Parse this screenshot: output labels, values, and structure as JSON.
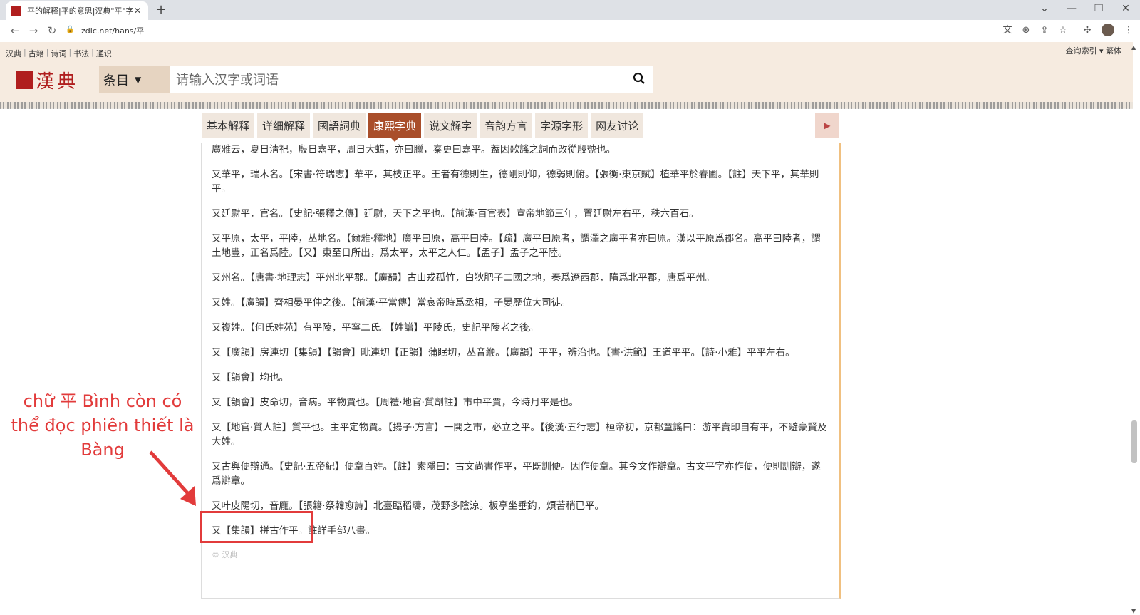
{
  "browser": {
    "tab_title": "平的解释|平的意思|汉典\"平\"字的",
    "tab_close": "✕",
    "new_tab": "+",
    "url": "zdic.net/hans/平",
    "win_minimize": "—",
    "win_restore": "❐",
    "win_close": "✕",
    "win_menu": "⌄"
  },
  "site": {
    "top_links": [
      "汉典",
      "古籍",
      "诗词",
      "书法",
      "通识"
    ],
    "top_right": "查询索引 ▾ 繁体",
    "logo_text": "漢典",
    "category_label": "条目",
    "search_placeholder": "请输入汉字或词语"
  },
  "tabs": [
    {
      "label": "基本解释",
      "active": false
    },
    {
      "label": "详细解释",
      "active": false
    },
    {
      "label": "國語詞典",
      "active": false
    },
    {
      "label": "康熙字典",
      "active": true
    },
    {
      "label": "说文解字",
      "active": false
    },
    {
      "label": "音韵方言",
      "active": false
    },
    {
      "label": "字源字形",
      "active": false
    },
    {
      "label": "网友讨论",
      "active": false
    }
  ],
  "content": {
    "paragraphs": [
      "廣雅云，夏日淸祀，殷日嘉平，周日大蜡，亦曰臘，秦更曰嘉平。葢因歌謠之詞而改從殷號也。",
      "又華平，瑞木名。【宋書·符瑞志】華平，其枝正平。王者有德則生，德剛則仰，德弱則俯。【張衡·東京賦】植華平於春圃。【註】天下平，其華則平。",
      "又廷尉平，官名。【史記·張釋之傳】廷尉，天下之平也。【前漢·百官表】宣帝地節三年，置廷尉左右平，秩六百石。",
      "又平原，太平，平陸，丛地名。【爾雅·釋地】廣平曰原，高平曰陸。【疏】廣平曰原者，謂澤之廣平者亦曰原。漢以平原爲郡名。高平曰陸者，謂土地豐，正名爲陸。【又】東至日所出，爲太平，太平之人仁。【孟子】孟子之平陸。",
      "又州名。【唐書·地理志】平州北平郡。【廣韻】古山戎孤竹，白狄肥子二國之地，秦爲遼西郡，隋爲北平郡，唐爲平州。",
      "又姓。【廣韻】齊相晏平仲之後。【前漢·平當傳】當哀帝時爲丞相，子晏歷位大司徒。",
      "又複姓。【何氏姓苑】有平陵，平寧二氏。【姓譜】平陵氏，史記平陵老之後。",
      "又【廣韻】房連切【集韻】【韻會】毗連切【正韻】蒲眠切，丛音緶。【廣韻】平平，辨治也。【書·洪範】王道平平。【詩·小雅】平平左右。",
      "又【韻會】均也。",
      "又【韻會】皮命切，音病。平物賈也。【周禮·地官·質劑註】市中平賈，今時月平是也。",
      "又【地官·質人註】質平也。主平定物賈。【揚子·方言】一閧之市，必立之平。【後漢·五行志】桓帝初，京都童謠曰：游平賣印自有平，不避豪賢及大姓。",
      "又古與便辯通。【史記·五帝紀】便章百姓。【註】索隱曰：古文尚書作平，平既訓便。因作便章。其今文作辯章。古文平字亦作便，便則訓辯，遂爲辯章。",
      "又叶皮陽切，音龐。【張籍·祭韓愈詩】北臺臨稻疇，茂野多陰涼。板亭坐垂釣，煩苦稍已平。",
      "又【集韻】拼古作平。註詳手部八畫。"
    ],
    "footer": "© 汉典"
  },
  "annotation": {
    "text": "chữ 平 Bình còn có thể đọc phiên thiết là Bàng",
    "color": "#e23b3b"
  },
  "colors": {
    "brand": "#b01e1e",
    "active_tab": "#a94e2a",
    "strip_bg": "#f6ebe0"
  }
}
